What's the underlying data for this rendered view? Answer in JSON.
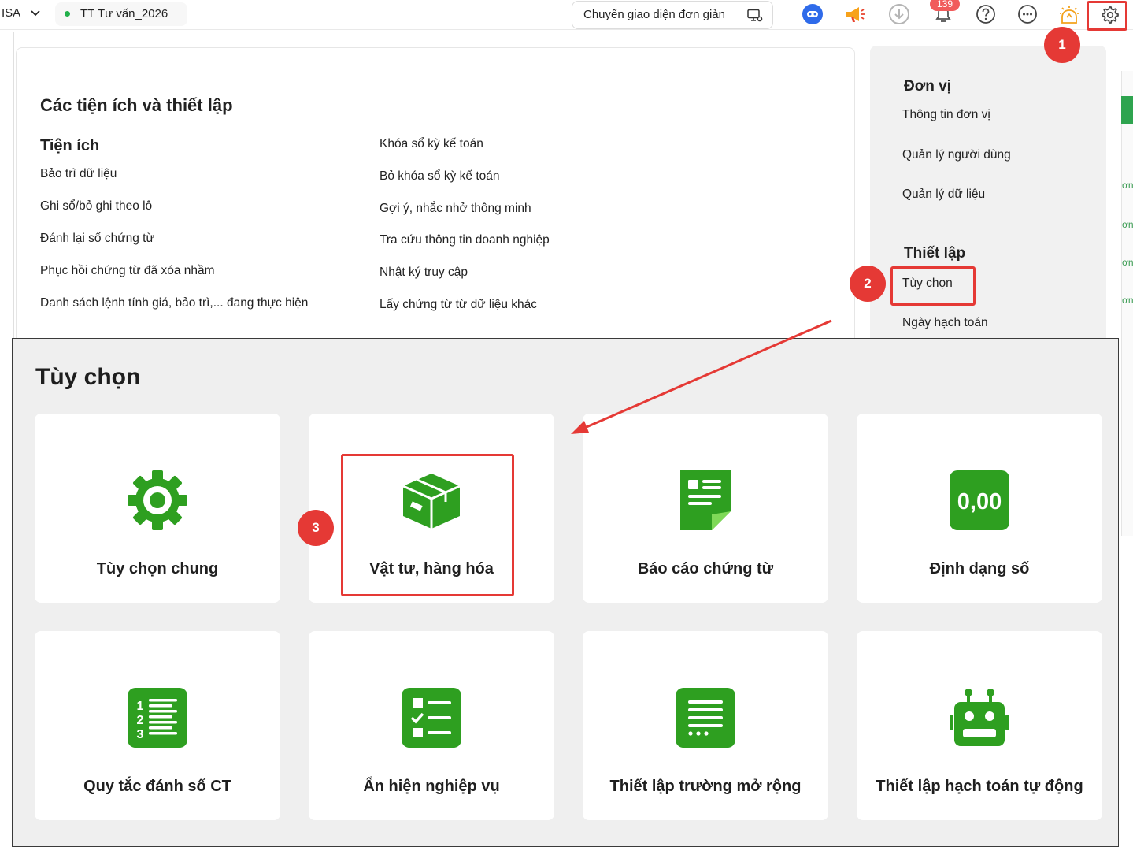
{
  "topbar": {
    "brand": "ISA",
    "database_name": "TT Tư vấn_2026",
    "switch_ui_label": "Chuyển giao diện đơn giản",
    "notification_count": "139",
    "icons": [
      "chevron-down-icon",
      "monitor-settings-icon",
      "assistant-avatar-icon",
      "megaphone-icon",
      "download-icon",
      "bell-icon",
      "help-icon",
      "more-icon",
      "lightbulb-icon",
      "gear-icon"
    ]
  },
  "utilities": {
    "title": "Các tiện ích và thiết lập",
    "subtitle": "Tiện ích",
    "col1": [
      "Bảo trì dữ liệu",
      "Ghi sổ/bỏ ghi theo lô",
      "Đánh lại số chứng từ",
      "Phục hồi chứng từ đã xóa nhầm",
      "Danh sách lệnh tính giá, bảo trì,... đang thực hiện"
    ],
    "col2": [
      "Khóa sổ kỳ kế toán",
      "Bỏ khóa sổ kỳ kế toán",
      "Gợi ý, nhắc nhở thông minh",
      "Tra cứu thông tin doanh nghiệp",
      "Nhật ký truy cập",
      "Lấy chứng từ từ dữ liệu khác"
    ]
  },
  "side_panel": {
    "unit_heading": "Đơn vị",
    "unit_links": [
      "Thông tin đơn vị",
      "Quản lý người dùng",
      "Quản lý dữ liệu"
    ],
    "setup_heading": "Thiết lập",
    "setup_links": [
      "Tùy chọn",
      "Ngày hạch toán"
    ]
  },
  "steps": [
    "1",
    "2",
    "3"
  ],
  "options": {
    "title": "Tùy chọn",
    "cards": [
      {
        "label": "Tùy chọn chung",
        "icon": "gear-icon"
      },
      {
        "label": "Vật tư, hàng hóa",
        "icon": "box-icon"
      },
      {
        "label": "Báo cáo chứng từ",
        "icon": "document-icon"
      },
      {
        "label": "Định dạng số",
        "icon": "number-format-icon",
        "icon_text": "0,00"
      },
      {
        "label": "Quy tắc đánh số CT",
        "icon": "numbered-list-icon"
      },
      {
        "label": "Ẩn hiện nghiệp vụ",
        "icon": "checklist-icon"
      },
      {
        "label": "Thiết lập trường mở rộng",
        "icon": "text-lines-icon"
      },
      {
        "label": "Thiết lập hạch toán tự động",
        "icon": "robot-icon"
      }
    ]
  },
  "colors": {
    "accent_green": "#2e9f20",
    "highlight_red": "#e53935",
    "badge_red": "#f15b5b"
  }
}
